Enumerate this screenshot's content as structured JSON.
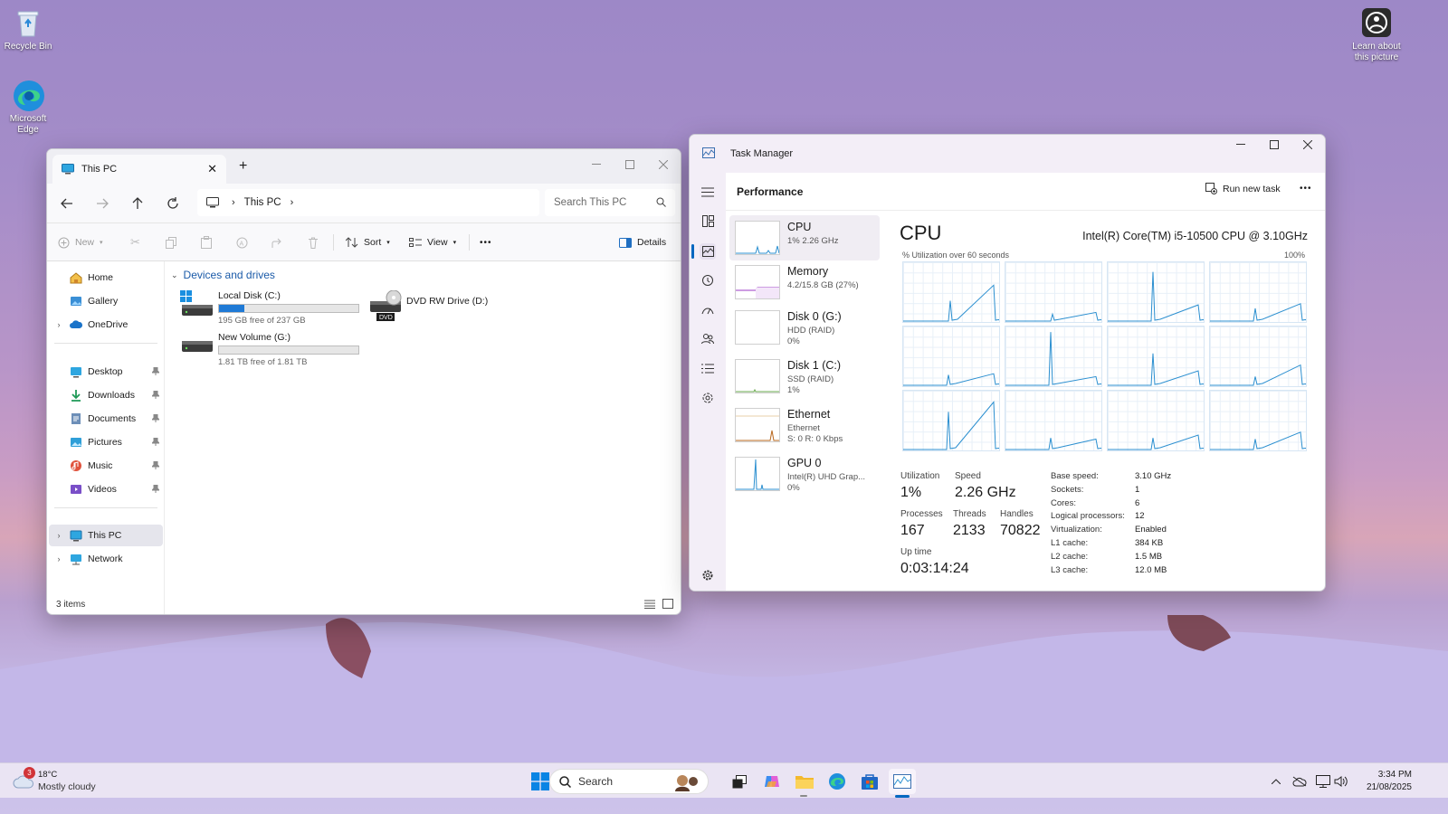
{
  "desktop": {
    "recycle_bin": "Recycle Bin",
    "edge_line1": "Microsoft",
    "edge_line2": "Edge",
    "learn_line1": "Learn about",
    "learn_line2": "this picture"
  },
  "explorer": {
    "tab_title": "This PC",
    "address": "This PC",
    "search_placeholder": "Search This PC",
    "commands": {
      "new": "New",
      "sort": "Sort",
      "view": "View",
      "more": "•••",
      "details": "Details"
    },
    "sidebar": {
      "home": "Home",
      "gallery": "Gallery",
      "onedrive": "OneDrive",
      "desktop": "Desktop",
      "downloads": "Downloads",
      "documents": "Documents",
      "pictures": "Pictures",
      "music": "Music",
      "videos": "Videos",
      "this_pc": "This PC",
      "network": "Network"
    },
    "section_title": "Devices and drives",
    "drives": [
      {
        "name": "Local Disk (C:)",
        "free": "195 GB free of 237 GB",
        "used_fraction": 0.18
      },
      {
        "name": "DVD RW Drive (D:)",
        "badge": "DVD"
      },
      {
        "name": "New Volume (G:)",
        "free": "1.81 TB free of 1.81 TB",
        "used_fraction": 0.0
      }
    ],
    "status": "3 items"
  },
  "taskmanager": {
    "title": "Task Manager",
    "page": "Performance",
    "run_new_task": "Run new task",
    "more": "•••",
    "perf_list": [
      {
        "name": "CPU",
        "sub1": "1% 2.26 GHz",
        "sub2": ""
      },
      {
        "name": "Memory",
        "sub1": "4.2/15.8 GB (27%)",
        "sub2": ""
      },
      {
        "name": "Disk 0 (G:)",
        "sub1": "HDD (RAID)",
        "sub2": "0%"
      },
      {
        "name": "Disk 1 (C:)",
        "sub1": "SSD (RAID)",
        "sub2": "1%"
      },
      {
        "name": "Ethernet",
        "sub1": "Ethernet",
        "sub2": "S: 0 R: 0 Kbps"
      },
      {
        "name": "GPU 0",
        "sub1": "Intel(R) UHD Grap...",
        "sub2": "0%"
      }
    ],
    "cpu": {
      "heading": "CPU",
      "model": "Intel(R) Core(TM) i5-10500 CPU @ 3.10GHz",
      "util_caption": "% Utilization over 60 seconds",
      "max_label": "100%",
      "utilization_label": "Utilization",
      "utilization": "1%",
      "speed_label": "Speed",
      "speed": "2.26 GHz",
      "processes_label": "Processes",
      "processes": "167",
      "threads_label": "Threads",
      "threads": "2133",
      "handles_label": "Handles",
      "handles": "70822",
      "uptime_label": "Up time",
      "uptime": "0:03:14:24",
      "specs": [
        {
          "label": "Base speed:",
          "value": "3.10 GHz"
        },
        {
          "label": "Sockets:",
          "value": "1"
        },
        {
          "label": "Cores:",
          "value": "6"
        },
        {
          "label": "Logical processors:",
          "value": "12"
        },
        {
          "label": "Virtualization:",
          "value": "Enabled"
        },
        {
          "label": "L1 cache:",
          "value": "384 KB"
        },
        {
          "label": "L2 cache:",
          "value": "1.5 MB"
        },
        {
          "label": "L3 cache:",
          "value": "12.0 MB"
        }
      ]
    }
  },
  "taskbar": {
    "weather_temp": "18°C",
    "weather_desc": "Mostly cloudy",
    "weather_badge": "3",
    "search": "Search",
    "time": "3:34 PM",
    "date": "21/08/2025"
  },
  "colors": {
    "accent": "#0067c0",
    "graph_line": "#2b8fd0",
    "memory_line": "#9b39c4",
    "ethernet_line": "#b9681f"
  }
}
